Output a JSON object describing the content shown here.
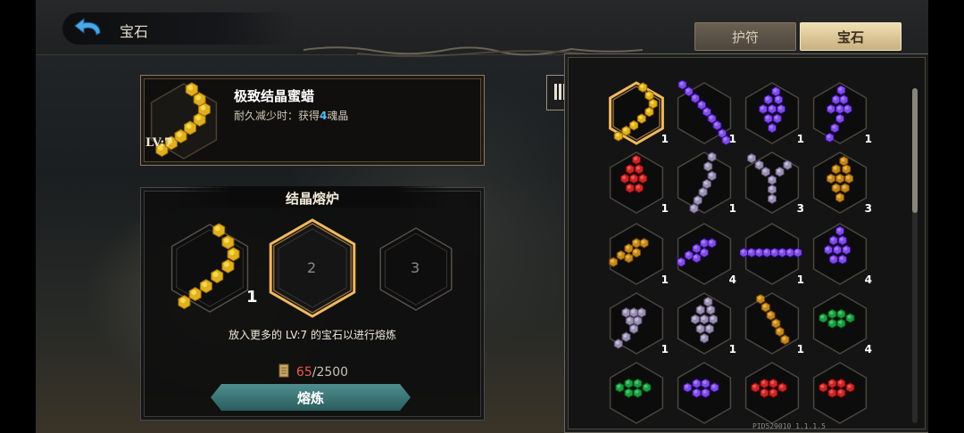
{
  "header": {
    "title": "宝石",
    "tabs": [
      {
        "label": "护符",
        "active": false
      },
      {
        "label": "宝石",
        "active": true
      }
    ]
  },
  "selected_gem": {
    "level_label": "LV:7",
    "name": "极致结晶蜜蜡",
    "desc_prefix": "耐久减少时：获得",
    "desc_value": "4",
    "desc_suffix": "魂晶",
    "color": "#e0b020",
    "pattern": "diag"
  },
  "furnace": {
    "title": "结晶熔炉",
    "slots": [
      {
        "label": "",
        "count": "1",
        "filled": true,
        "color": "#e0b020",
        "pattern": "diag"
      },
      {
        "label": "2",
        "count": "",
        "filled": false,
        "highlighted": true
      },
      {
        "label": "3",
        "count": "",
        "filled": false,
        "highlighted": false
      }
    ],
    "hint": "放入更多的 LV:7 的宝石以进行熔炼",
    "cost_current": "65",
    "cost_sep_max": "/2500",
    "smelt_label": "熔炼"
  },
  "inventory": {
    "gems": [
      {
        "color": "#e0b020",
        "pattern": "diag",
        "count": "1",
        "selected": true
      },
      {
        "color": "#7d4fe0",
        "pattern": "diag2",
        "count": "1"
      },
      {
        "color": "#7d4fe0",
        "pattern": "tri",
        "count": "1"
      },
      {
        "color": "#7d4fe0",
        "pattern": "vbranch",
        "count": "1"
      },
      {
        "color": "#c42a2a",
        "pattern": "cluster",
        "count": "1"
      },
      {
        "color": "#9a90b0",
        "pattern": "vzig",
        "count": "1"
      },
      {
        "color": "#9a90b0",
        "pattern": "ystar",
        "count": "3"
      },
      {
        "color": "#c08a20",
        "pattern": "tri",
        "count": "3"
      },
      {
        "color": "#c08a20",
        "pattern": "flat",
        "count": "1"
      },
      {
        "color": "#7d4fe0",
        "pattern": "flat",
        "count": "4"
      },
      {
        "color": "#7d4fe0",
        "pattern": "line",
        "count": "1"
      },
      {
        "color": "#7d4fe0",
        "pattern": "cluster",
        "count": "4"
      },
      {
        "color": "#9a90b0",
        "pattern": "zig",
        "count": "1"
      },
      {
        "color": "#9a90b0",
        "pattern": "tri",
        "count": "1"
      },
      {
        "color": "#c08a20",
        "pattern": "diag3",
        "count": "1"
      },
      {
        "color": "#1e9a48",
        "pattern": "bar",
        "count": "4"
      },
      {
        "color": "#1e9a48",
        "pattern": "bar",
        "count": ""
      },
      {
        "color": "#7d4fe0",
        "pattern": "bar",
        "count": ""
      },
      {
        "color": "#c42a2a",
        "pattern": "bar",
        "count": ""
      },
      {
        "color": "#c42a2a",
        "pattern": "bar",
        "count": ""
      }
    ],
    "footer_id": "PID529010  1.1.1.5"
  }
}
